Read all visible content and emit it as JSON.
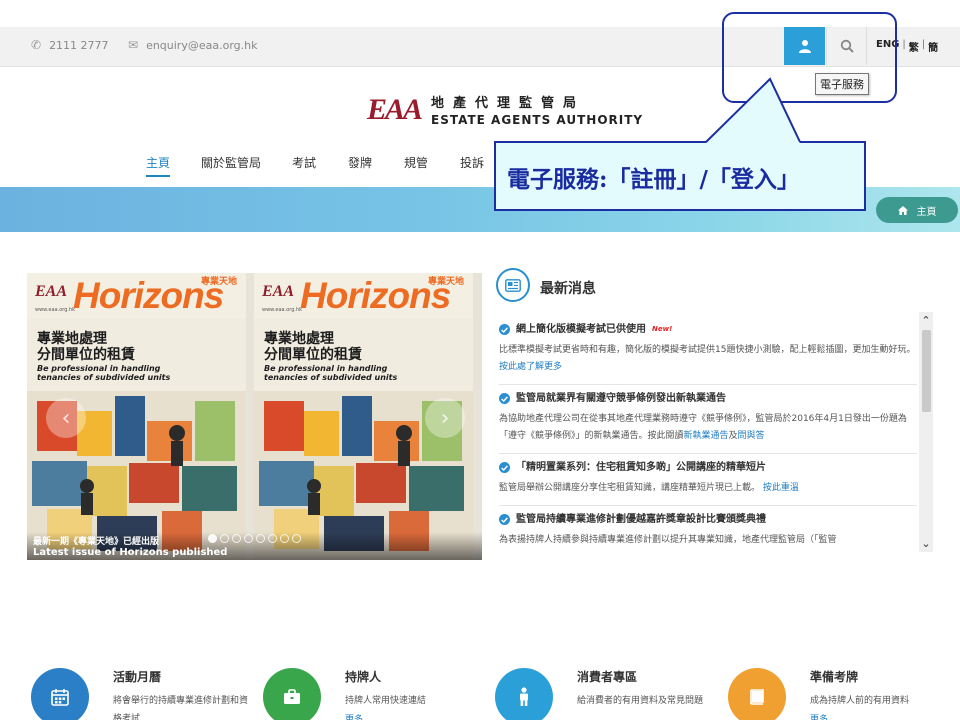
{
  "topbar": {
    "phone": "2111 2777",
    "email": "enquiry@eaa.org.hk",
    "lang": [
      "ENG",
      "繁",
      "簡"
    ],
    "tooltip": "電子服務"
  },
  "logo": {
    "mark": "EAA",
    "name_zh": "地產代理監管局",
    "name_en": "ESTATE AGENTS AUTHORITY"
  },
  "nav": [
    {
      "label": "主頁",
      "active": true
    },
    {
      "label": "關於監管局"
    },
    {
      "label": "考試"
    },
    {
      "label": "發牌"
    },
    {
      "label": "規管"
    },
    {
      "label": "投訴"
    }
  ],
  "breadcrumb": "主頁",
  "callout": {
    "text": "電子服務:「註冊」/「登入」"
  },
  "carousel": {
    "magazine": {
      "logo": "EAA",
      "title": "Horizons",
      "tag": "專業天地",
      "site": "www.eaa.org.hk",
      "heading_zh_1": "專業地處理",
      "heading_zh_2": "分間單位的租賃",
      "heading_en_1": "Be professional in handling",
      "heading_en_2": "tenancies of subdivided units"
    },
    "caption_zh": "最新一期《專業天地》已經出版",
    "caption_en": "Latest issue of Horizons published"
  },
  "news": {
    "title": "最新消息",
    "new_label": "New!",
    "items": [
      {
        "title": "網上簡化版模擬考試已供使用",
        "is_new": true,
        "body": "比標準模擬考試更省時和有趣，簡化版的模擬考試提供15題快捷小測驗，配上輕鬆插圖，更加生動好玩。",
        "link": "按此處了解更多"
      },
      {
        "title": "監管局就業界有關遵守競爭條例發出新執業通告",
        "body": "為協助地產代理公司在從事其地產代理業務時遵守《競爭條例》，監管局於2016年4月1日發出一份題為「遵守《競爭條例》」的新執業通告。按此閱讀",
        "link": "新執業通告",
        "link_sep": "及",
        "link2": "問與答"
      },
      {
        "title": "「精明置業系列：住宅租賃知多啲」公開講座的精華短片",
        "body": "監管局舉辦公開講座分享住宅租賃知識，講座精華短片現已上載。",
        "link": "按此重溫"
      },
      {
        "title": "監管局持續專業進修計劃優越嘉許獎章設計比賽頒獎典禮",
        "body": "為表揚持牌人持續參與持續專業進修計劃以提升其專業知識，地產代理監管局（「監管"
      }
    ]
  },
  "features": [
    {
      "title": "活動月曆",
      "desc": "將會舉行的持續專業進修計劃和資格考試",
      "color": "#2b7fc6",
      "icon": "calendar-icon"
    },
    {
      "title": "持牌人",
      "desc": "持牌人常用快速連結",
      "more": "更多",
      "color": "#3aa64b",
      "icon": "briefcase-icon"
    },
    {
      "title": "消費者專區",
      "desc": "給消費者的有用資料及常見問題",
      "color": "#2a9fd8",
      "icon": "person-icon"
    },
    {
      "title": "準備考牌",
      "desc": "成為持牌人前的有用資料",
      "more": "更多",
      "color": "#f0a030",
      "icon": "book-icon"
    }
  ],
  "colors": {
    "accent": "#2a9fd8",
    "brand": "#9a1b2c",
    "callout": "#1b2fa3"
  }
}
